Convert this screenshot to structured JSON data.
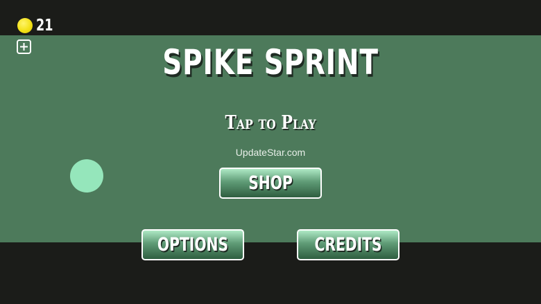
{
  "game": {
    "title": "SPIKE SPRINT",
    "prompt": "Tap to Play",
    "watermark": "UpdateStar.com"
  },
  "hud": {
    "coins": "21",
    "coin_icon": "coin-icon",
    "add_icon": "plus-square-icon"
  },
  "menu": {
    "shop_label": "SHOP",
    "options_label": "OPTIONS",
    "credits_label": "CREDITS"
  },
  "colors": {
    "background_dark": "#1b1c19",
    "field_green": "#4d7a5b",
    "player_ball": "#95e6bb",
    "coin_yellow": "#f3e116",
    "text_white": "#ffffff"
  }
}
